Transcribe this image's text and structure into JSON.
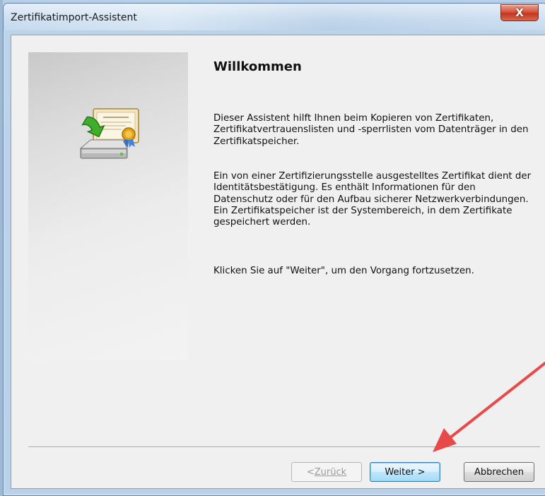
{
  "window": {
    "title": "Zertifikatimport-Assistent",
    "close_symbol": "X"
  },
  "content": {
    "heading": "Willkommen",
    "paragraph1": "Dieser Assistent hilft Ihnen beim Kopieren von Zertifikaten, Zertifikatvertrauenslisten und -sperrlisten vom Datenträger in den Zertifikatspeicher.",
    "paragraph2": "Ein von einer Zertifizierungsstelle ausgestelltes Zertifikat dient der Identitätsbestätigung. Es enthält Informationen für den Datenschutz oder für den Aufbau sicherer Netzwerkverbindungen. Ein Zertifikatspeicher ist der Systembereich, in dem Zertifikate gespeichert werden.",
    "paragraph3": "Klicken Sie auf \"Weiter\", um den Vorgang fortzusetzen."
  },
  "buttons": {
    "back_prefix": "< ",
    "back_label": "Zurück",
    "next_label": "Weiter >",
    "cancel_label": "Abbrechen"
  },
  "icons": {
    "wizard": "certificate-import-icon",
    "close": "close-icon"
  },
  "colors": {
    "annotation_arrow": "#e84a4a",
    "default_button_border": "#3c7fb1"
  }
}
